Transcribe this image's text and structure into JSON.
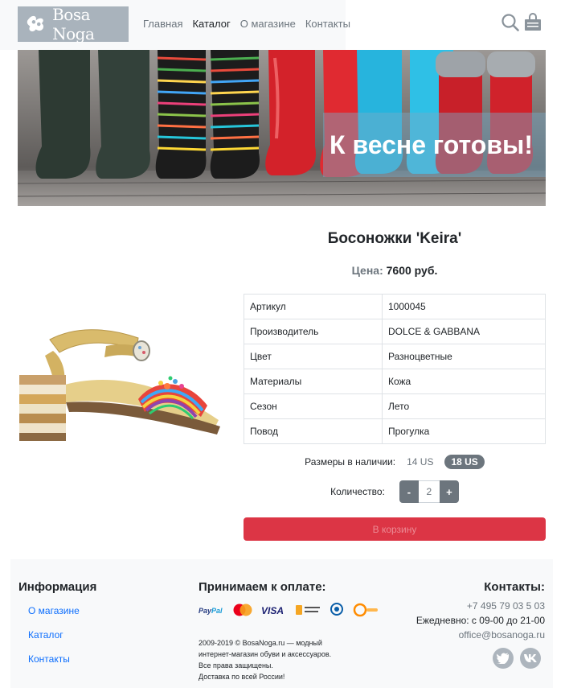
{
  "header": {
    "logo_text": "Bosa Noga",
    "nav": [
      {
        "label": "Главная"
      },
      {
        "label": "Каталог"
      },
      {
        "label": "О магазине"
      },
      {
        "label": "Контакты"
      }
    ],
    "icons": [
      "search-icon",
      "cart-icon"
    ]
  },
  "banner": {
    "caption": "К весне готовы!"
  },
  "product": {
    "title": "Босоножки 'Keira'",
    "price_label": "Цена:",
    "price_value": "7600 руб.",
    "specs": [
      {
        "key": "Артикул",
        "value": "1000045"
      },
      {
        "key": "Производитель",
        "value": "DOLCE & GABBANA"
      },
      {
        "key": "Цвет",
        "value": "Разноцветные"
      },
      {
        "key": "Материалы",
        "value": "Кожа"
      },
      {
        "key": "Сезон",
        "value": "Лето"
      },
      {
        "key": "Повод",
        "value": "Прогулка"
      }
    ],
    "sizes_label": "Размеры в наличии:",
    "sizes": [
      {
        "label": "14 US",
        "selected": false
      },
      {
        "label": "18 US",
        "selected": true
      }
    ],
    "quantity_label": "Количество:",
    "quantity_minus": "-",
    "quantity_value": "2",
    "quantity_plus": "+",
    "cart_button": "В корзину"
  },
  "footer": {
    "info_heading": "Информация",
    "info_links": [
      {
        "label": "О магазине"
      },
      {
        "label": "Каталог"
      },
      {
        "label": "Контакты"
      }
    ],
    "payment_heading": "Принимаем к оплате:",
    "payment_methods": [
      {
        "label": "PayPal",
        "color": "#253b80"
      },
      {
        "label": "MasterCard",
        "color": "#eb001b"
      },
      {
        "label": "VISA",
        "color": "#1a1f71"
      },
      {
        "label": "Яндекс.Деньги",
        "color": "#f5a623"
      },
      {
        "label": "WebMoney",
        "color": "#0a5ea8"
      },
      {
        "label": "QIWI",
        "color": "#ff8c00"
      }
    ],
    "copyright_lines": [
      "2009-2019 © BosaNoga.ru — модный",
      "интернет-магазин обуви и аксессуаров.",
      "Все права защищены.",
      "Доставка по всей России!"
    ],
    "contacts_heading": "Контакты:",
    "phone": "+7 495 79 03 5 03",
    "hours": "Ежедневно: с 09-00 до 21-00",
    "email": "office@bosanoga.ru",
    "social": [
      {
        "label": "twitter-icon"
      },
      {
        "label": "vk-icon"
      }
    ]
  },
  "colors": {
    "accent_red": "#dc3545",
    "secondary": "#6c757d",
    "link": "#0d6efd",
    "logo_bg": "#a9b3bc"
  }
}
